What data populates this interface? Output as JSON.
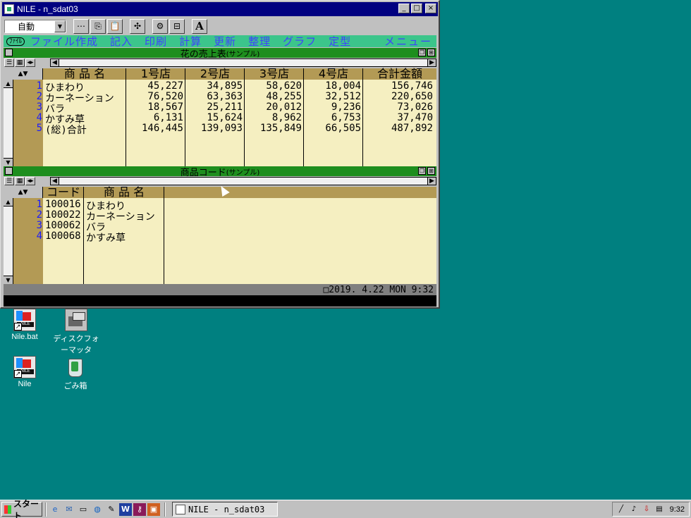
{
  "window": {
    "title": "NILE - n_sdat03",
    "minimize": "_",
    "maximize": "□",
    "close": "×"
  },
  "toolbar": {
    "mode_value": "自動",
    "buttons": [
      "⋯",
      "⎘",
      "📋",
      "✣",
      "⚙",
      "⊟",
      "A"
    ]
  },
  "menubar": {
    "file_tab": "ﾌｧｲﾙ",
    "items": [
      "ファイル作成",
      "記入",
      "印刷",
      "計算",
      "更新",
      "整理",
      "グラフ",
      "定型"
    ],
    "right_item": "メニュー"
  },
  "pane1": {
    "title": "花の売上表",
    "subtitle": "(サンプル)",
    "headers": [
      "商 品 名",
      "1号店",
      "2号店",
      "3号店",
      "4号店",
      "合計金額"
    ],
    "rows": [
      {
        "no": "1",
        "name": "ひまわり",
        "s1": "45,227",
        "s2": "34,895",
        "s3": "58,620",
        "s4": "18,004",
        "total": "156,746"
      },
      {
        "no": "2",
        "name": "カーネーション",
        "s1": "76,520",
        "s2": "63,363",
        "s3": "48,255",
        "s4": "32,512",
        "total": "220,650"
      },
      {
        "no": "3",
        "name": "バラ",
        "s1": "18,567",
        "s2": "25,211",
        "s3": "20,012",
        "s4": "9,236",
        "total": "73,026"
      },
      {
        "no": "4",
        "name": "かすみ草",
        "s1": "6,131",
        "s2": "15,624",
        "s3": "8,962",
        "s4": "6,753",
        "total": "37,470"
      },
      {
        "no": "5",
        "name": "(総)合計",
        "s1": "146,445",
        "s2": "139,093",
        "s3": "135,849",
        "s4": "66,505",
        "total": "487,892"
      }
    ]
  },
  "pane2": {
    "title": "商品コード",
    "subtitle": "(サンプル)",
    "headers": [
      "コード",
      "商 品 名"
    ],
    "rows": [
      {
        "no": "1",
        "code": "100016",
        "name": "ひまわり"
      },
      {
        "no": "2",
        "code": "100022",
        "name": "カーネーション"
      },
      {
        "no": "3",
        "code": "100062",
        "name": "バラ"
      },
      {
        "no": "4",
        "code": "100068",
        "name": "かすみ草"
      }
    ]
  },
  "statusbar": {
    "datetime": "□2019. 4.22 MON  9:32"
  },
  "desktop": {
    "icons": [
      "Nile.bat",
      "ディスクフォーマッタ",
      "Nile",
      "ごみ箱"
    ]
  },
  "taskbar": {
    "start_label": "スタート",
    "task_label": "NILE - n_sdat03",
    "clock": "9:32",
    "quick_launch": [
      "ie-icon",
      "outlook-icon",
      "desktop-icon",
      "channel-icon",
      "notepad-icon",
      "word-icon",
      "access-icon",
      "powerpoint-icon"
    ]
  },
  "colors": {
    "desktop": "#008080",
    "titlebar": "#000080",
    "menubar": "#3cc58b",
    "pane_title": "#1e8e1e",
    "grid_bg": "#f5efc1",
    "grid_header": "#b39a55",
    "header_text": "#1a1aff"
  }
}
